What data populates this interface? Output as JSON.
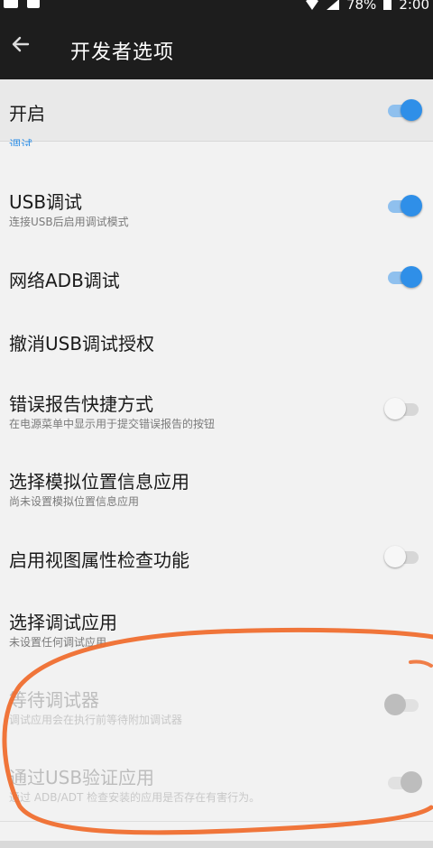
{
  "status_bar": {
    "battery_percent": "78%",
    "time": "2:00",
    "icons": [
      "image-icon",
      "app-icon",
      "wifi-icon",
      "signal-icon",
      "battery-charging-icon"
    ]
  },
  "app_bar": {
    "back_icon": "arrow-left-icon",
    "title": "开发者选项"
  },
  "master": {
    "label": "开启",
    "enabled": true
  },
  "category_partial": "调试",
  "settings": [
    {
      "title": "USB调试",
      "summary": "连接USB后启用调试模式",
      "switch": "on"
    },
    {
      "title": "网络ADB调试",
      "summary": "",
      "switch": "on"
    },
    {
      "title": "撤消USB调试授权",
      "summary": "",
      "switch": "none"
    },
    {
      "title": "错误报告快捷方式",
      "summary": "在电源菜单中显示用于提交错误报告的按钮",
      "switch": "off"
    },
    {
      "title": "选择模拟位置信息应用",
      "summary": "尚未设置模拟位置信息应用",
      "switch": "none"
    },
    {
      "title": "启用视图属性检查功能",
      "summary": "",
      "switch": "off"
    },
    {
      "title": "选择调试应用",
      "summary": "未设置任何调试应用",
      "switch": "none"
    },
    {
      "title": "等待调试器",
      "summary": "调试应用会在执行前等待附加调试器",
      "switch": "disabled-off"
    },
    {
      "title": "通过USB验证应用",
      "summary": "通过 ADB/ADT 检查安装的应用是否存在有害行为。",
      "switch": "disabled-on"
    }
  ],
  "colors": {
    "accent": "#2f8fe8",
    "annotation_circle": "#f06a2a",
    "app_bar": "#1d1d1d"
  }
}
